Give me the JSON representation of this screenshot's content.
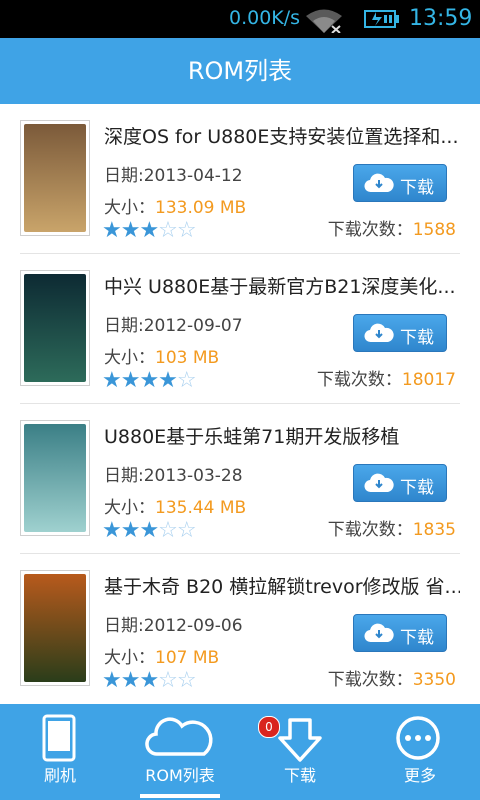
{
  "status": {
    "net_speed": "0.00K/s",
    "time": "13:59",
    "wifi_icon": "wifi-icon",
    "battery_icon": "battery-charging-icon"
  },
  "header": {
    "title": "ROM列表"
  },
  "items": [
    {
      "title": "深度OS for U880E支持安装位置选择和...",
      "date": "日期:2013-04-12",
      "size_label": "大小：",
      "size_value": "133.09 MB",
      "rating": 3,
      "rating_max": 5,
      "download_label": "下载",
      "count_label": "下载次数：",
      "count_value": "1588",
      "thumb_colors": [
        "#7b5a3a",
        "#c9a46a"
      ]
    },
    {
      "title": "中兴 U880E基于最新官方B21深度美化...",
      "date": "日期:2012-09-07",
      "size_label": "大小：",
      "size_value": "103 MB",
      "rating": 4,
      "rating_max": 5,
      "download_label": "下载",
      "count_label": "下载次数：",
      "count_value": "18017",
      "thumb_colors": [
        "#0d2a33",
        "#2d6b5a"
      ]
    },
    {
      "title": "U880E基于乐蛙第71期开发版移植",
      "date": "日期:2013-03-28",
      "size_label": "大小：",
      "size_value": "135.44 MB",
      "rating": 3,
      "rating_max": 5,
      "download_label": "下载",
      "count_label": "下载次数：",
      "count_value": "1835",
      "thumb_colors": [
        "#3b7f86",
        "#9fd1cf"
      ]
    },
    {
      "title": "基于木奇 B20 横拉解锁trevor修改版 省...",
      "date": "日期:2012-09-06",
      "size_label": "大小：",
      "size_value": "107 MB",
      "rating": 3,
      "rating_max": 5,
      "download_label": "下载",
      "count_label": "下载次数：",
      "count_value": "3350",
      "thumb_colors": [
        "#b85a1c",
        "#2a3d1a"
      ]
    }
  ],
  "tabs": [
    {
      "label": "刷机",
      "icon": "phone-icon"
    },
    {
      "label": "ROM列表",
      "icon": "cloud-icon",
      "active": true
    },
    {
      "label": "下载",
      "icon": "download-arrow-icon",
      "badge": "0"
    },
    {
      "label": "更多",
      "icon": "more-dots-icon"
    }
  ],
  "colors": {
    "accent": "#3fa3e6",
    "highlight": "#f39a1f",
    "star_on": "#3a96d8",
    "star_off": "#a9d0ef"
  }
}
